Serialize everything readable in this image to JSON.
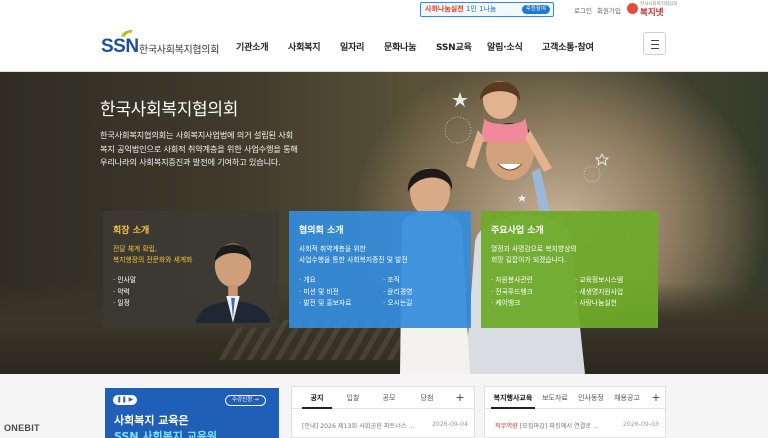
{
  "topbar": {
    "promo_highlight": "사회나눔실천",
    "promo_text": "1인 1나눔",
    "promo_button": "후원참여",
    "util_links": [
      "로그인",
      "회원가입"
    ],
    "partner_sub": "한국사회복지협의회",
    "partner_name": "복지넷"
  },
  "header": {
    "logo_mark": "SSN",
    "logo_text": "한국사회복지협의회",
    "nav": [
      "기관소개",
      "사회복지",
      "일자리",
      "문화나눔",
      "SSN교육",
      "알림·소식",
      "고객소통·참여"
    ],
    "menu_icon": "hamburger-icon"
  },
  "hero": {
    "title": "한국사회복지협의회",
    "desc_lines": [
      "한국사회복지협의회는 사회복지사업법에 의거 설립된 사회",
      "복지 공익법인으로 사회적 취약계층을 위한 사업수행을 통해",
      "우리나라의 사회복지증진과 발전에 기여하고 있습니다."
    ]
  },
  "cards": {
    "president": {
      "title": "회장 소개",
      "desc_lines": [
        "전달 체계 확립,",
        "복지행정의 전문화와 세계화"
      ],
      "links": [
        "인사말",
        "약력",
        "일정"
      ]
    },
    "council": {
      "title": "협의회 소개",
      "desc_lines": [
        "사회적 취약계층을 위한",
        "사업수행을 통한 사회복지증진 및 발전"
      ],
      "links": [
        "개요",
        "조직",
        "미션 및 비전",
        "윤리경영",
        "발전 및 홍보자료",
        "오시는길"
      ]
    },
    "business": {
      "title": "주요사업 소개",
      "desc_lines": [
        "열정과 사명감으로 복지향상의",
        "희망 길잡이가 되겠습니다."
      ],
      "links": [
        "자원봉사관련",
        "교육정보시스템",
        "전국푸드뱅크",
        "새생명지원사업",
        "케어뱅크",
        "사랑나눔실천"
      ]
    }
  },
  "bottom": {
    "banner": {
      "controls": "❚❚ ▶",
      "apply_label": "수강신청 →",
      "line1": "사회복지 교육은",
      "line2": "SSN 사회복지 교육원"
    },
    "board1": {
      "tabs": [
        "공지",
        "입찰",
        "공모",
        "당첨"
      ],
      "plus": "+",
      "row_text": "[안내] 2026 제13회 사회공헌 파트너스 ...",
      "row_date": "2026-09-04"
    },
    "board2": {
      "tabs": [
        "복지행사교육",
        "보도자료",
        "인사동정",
        "채용공고"
      ],
      "plus": "+",
      "row_tag": "직무역량",
      "row_text": "[모집마감] 파킹에서 연결로 ...",
      "row_date": "2026-09-03"
    }
  },
  "watermark": "ONEBIT",
  "colors": {
    "brand_blue": "#1d4f9c",
    "card_gray": "#3c3a34",
    "card_blue": "#348cdc",
    "card_green": "#6caa28",
    "accent_yellow": "#f5c33a"
  }
}
